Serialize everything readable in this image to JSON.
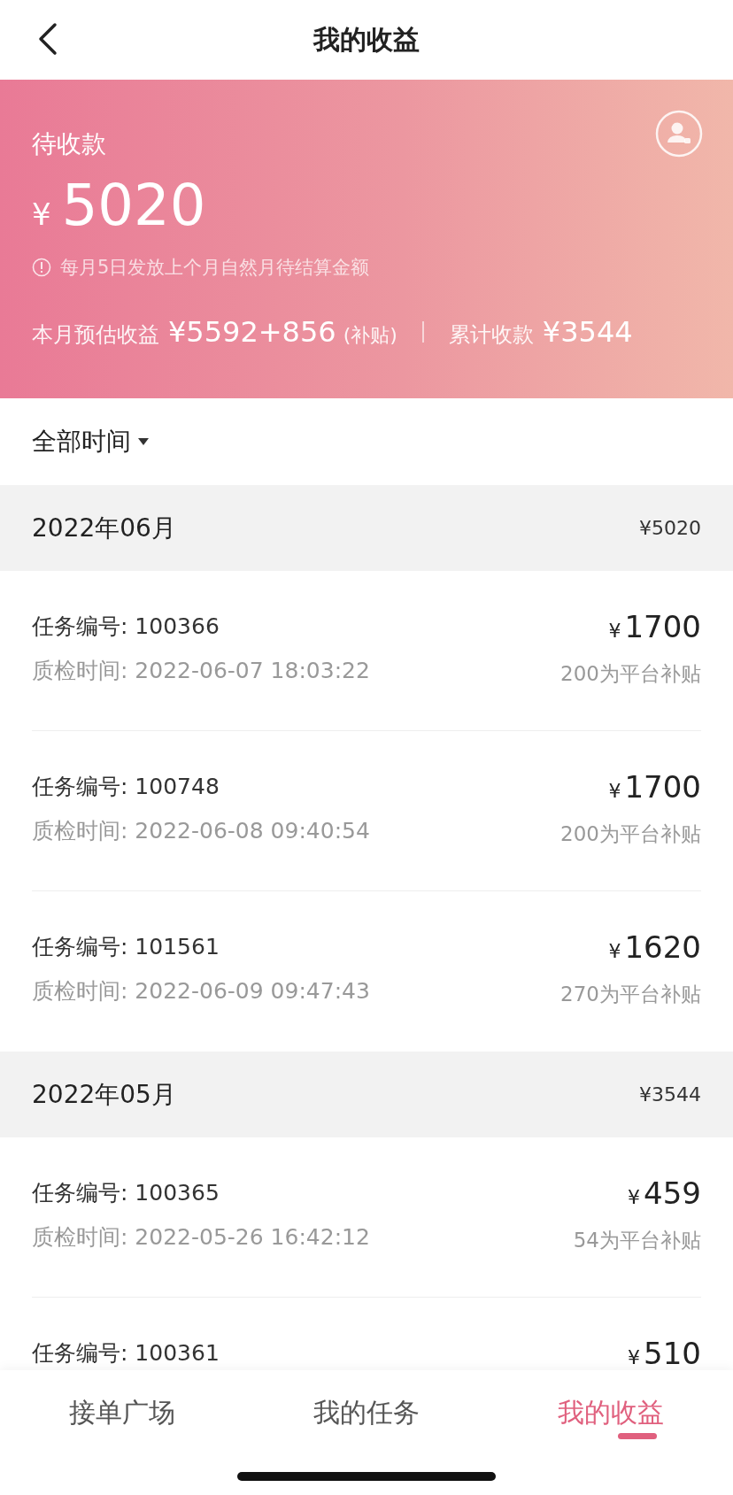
{
  "header": {
    "title": "我的收益"
  },
  "banner": {
    "label": "待收款",
    "currency": "¥",
    "amount": "5020",
    "note": "每月5日发放上个月自然月待结算金额",
    "estimate_label": "本月预估收益",
    "estimate_value": "¥5592+856",
    "estimate_suffix": "(补贴)",
    "total_label": "累计收款",
    "total_value": "¥3544"
  },
  "filter": {
    "label": "全部时间"
  },
  "groups": [
    {
      "month": "2022年06月",
      "total": "¥5020",
      "items": [
        {
          "task": "任务编号: 100366",
          "time": "质检时间: 2022-06-07 18:03:22",
          "currency": "¥",
          "amount": "1700",
          "subsidy": "200为平台补贴"
        },
        {
          "task": "任务编号: 100748",
          "time": "质检时间: 2022-06-08 09:40:54",
          "currency": "¥",
          "amount": "1700",
          "subsidy": "200为平台补贴"
        },
        {
          "task": "任务编号: 101561",
          "time": "质检时间: 2022-06-09 09:47:43",
          "currency": "¥",
          "amount": "1620",
          "subsidy": "270为平台补贴"
        }
      ]
    },
    {
      "month": "2022年05月",
      "total": "¥3544",
      "items": [
        {
          "task": "任务编号: 100365",
          "time": "质检时间: 2022-05-26 16:42:12",
          "currency": "¥",
          "amount": "459",
          "subsidy": "54为平台补贴"
        },
        {
          "task": "任务编号: 100361",
          "currency": "¥",
          "amount": "510"
        }
      ]
    }
  ],
  "tabs": [
    {
      "label": "接单广场",
      "selected": false
    },
    {
      "label": "我的任务",
      "selected": false
    },
    {
      "label": "我的收益",
      "selected": true
    }
  ]
}
